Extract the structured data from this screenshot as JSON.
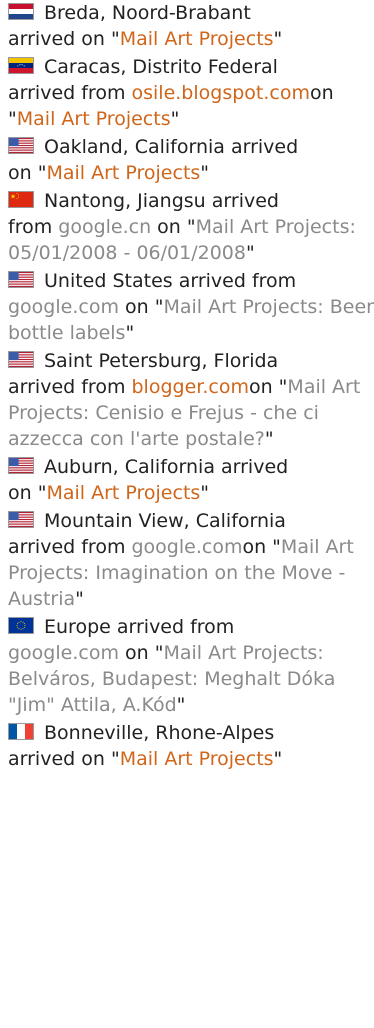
{
  "feed": {
    "entries": [
      {
        "flag": "nl-flag-icon",
        "location": "Breda, Noord-Brabant",
        "line_break_before_arrived": true,
        "arrived_text": "arrived on \"",
        "source": null,
        "page_title": "Mail Art Projects",
        "page_title_color": "orange"
      },
      {
        "flag": "ve-flag-icon",
        "location": "Caracas, Distrito Federal",
        "arrived_text": "arrived from ",
        "source": "osile.blogspot.com",
        "source_color": "orange",
        "on_text": "on \"",
        "page_title": "Mail Art Projects",
        "page_title_color": "orange"
      },
      {
        "flag": "us-flag-icon",
        "location": "Oakland, California arrived",
        "arrived_text": "on \"",
        "source": null,
        "page_title": "Mail Art Projects",
        "page_title_color": "orange"
      },
      {
        "flag": "cn-flag-icon",
        "location": "Nantong, Jiangsu arrived",
        "arrived_text": "from ",
        "source": "google.cn",
        "source_color": "gray",
        "on_text": " on \"",
        "page_title": "Mail Art Projects: 05/01/2008 - 06/01/2008",
        "page_title_color": "gray"
      },
      {
        "flag": "us-flag-icon",
        "location": "United States arrived from",
        "arrived_text": "",
        "source": "google.com",
        "source_color": "gray",
        "on_text": " on \"",
        "page_title": "Mail Art Projects: Beer bottle labels",
        "page_title_color": "gray"
      },
      {
        "flag": "us-flag-icon",
        "location": "Saint Petersburg, Florida",
        "arrived_text": "arrived from ",
        "source": "blogger.com",
        "source_color": "orange",
        "on_text": "on \"",
        "page_title": "Mail Art Projects: Cenisio e Frejus - che ci azzecca con l'arte postale?",
        "page_title_color": "gray"
      },
      {
        "flag": "us-flag-icon",
        "location": "Auburn, California arrived",
        "arrived_text": "on \"",
        "source": null,
        "page_title": "Mail Art Projects",
        "page_title_color": "orange"
      },
      {
        "flag": "us-flag-icon",
        "location": "Mountain View, California",
        "arrived_text": "arrived from ",
        "source": "google.com",
        "source_color": "gray",
        "on_text": "on \"",
        "page_title": "Mail Art Projects: Imagination on the Move - Austria",
        "page_title_color": "gray"
      },
      {
        "flag": "eu-flag-icon",
        "location": "Europe arrived from",
        "arrived_text": "",
        "source": "google.com",
        "source_color": "gray",
        "on_text": " on \"",
        "page_title": "Mail Art Projects: Belváros, Budapest: Meghalt Dóka \"Jim\" Attila, A.Kód",
        "page_title_color": "gray"
      },
      {
        "flag": "fr-flag-icon",
        "location": "Bonneville, Rhone-Alpes",
        "arrived_text": "arrived on \"",
        "source": null,
        "page_title": "Mail Art Projects",
        "page_title_color": "orange"
      }
    ]
  },
  "colors": {
    "orange": "#d0661a",
    "gray": "#8a8a8a",
    "text": "#222222"
  }
}
